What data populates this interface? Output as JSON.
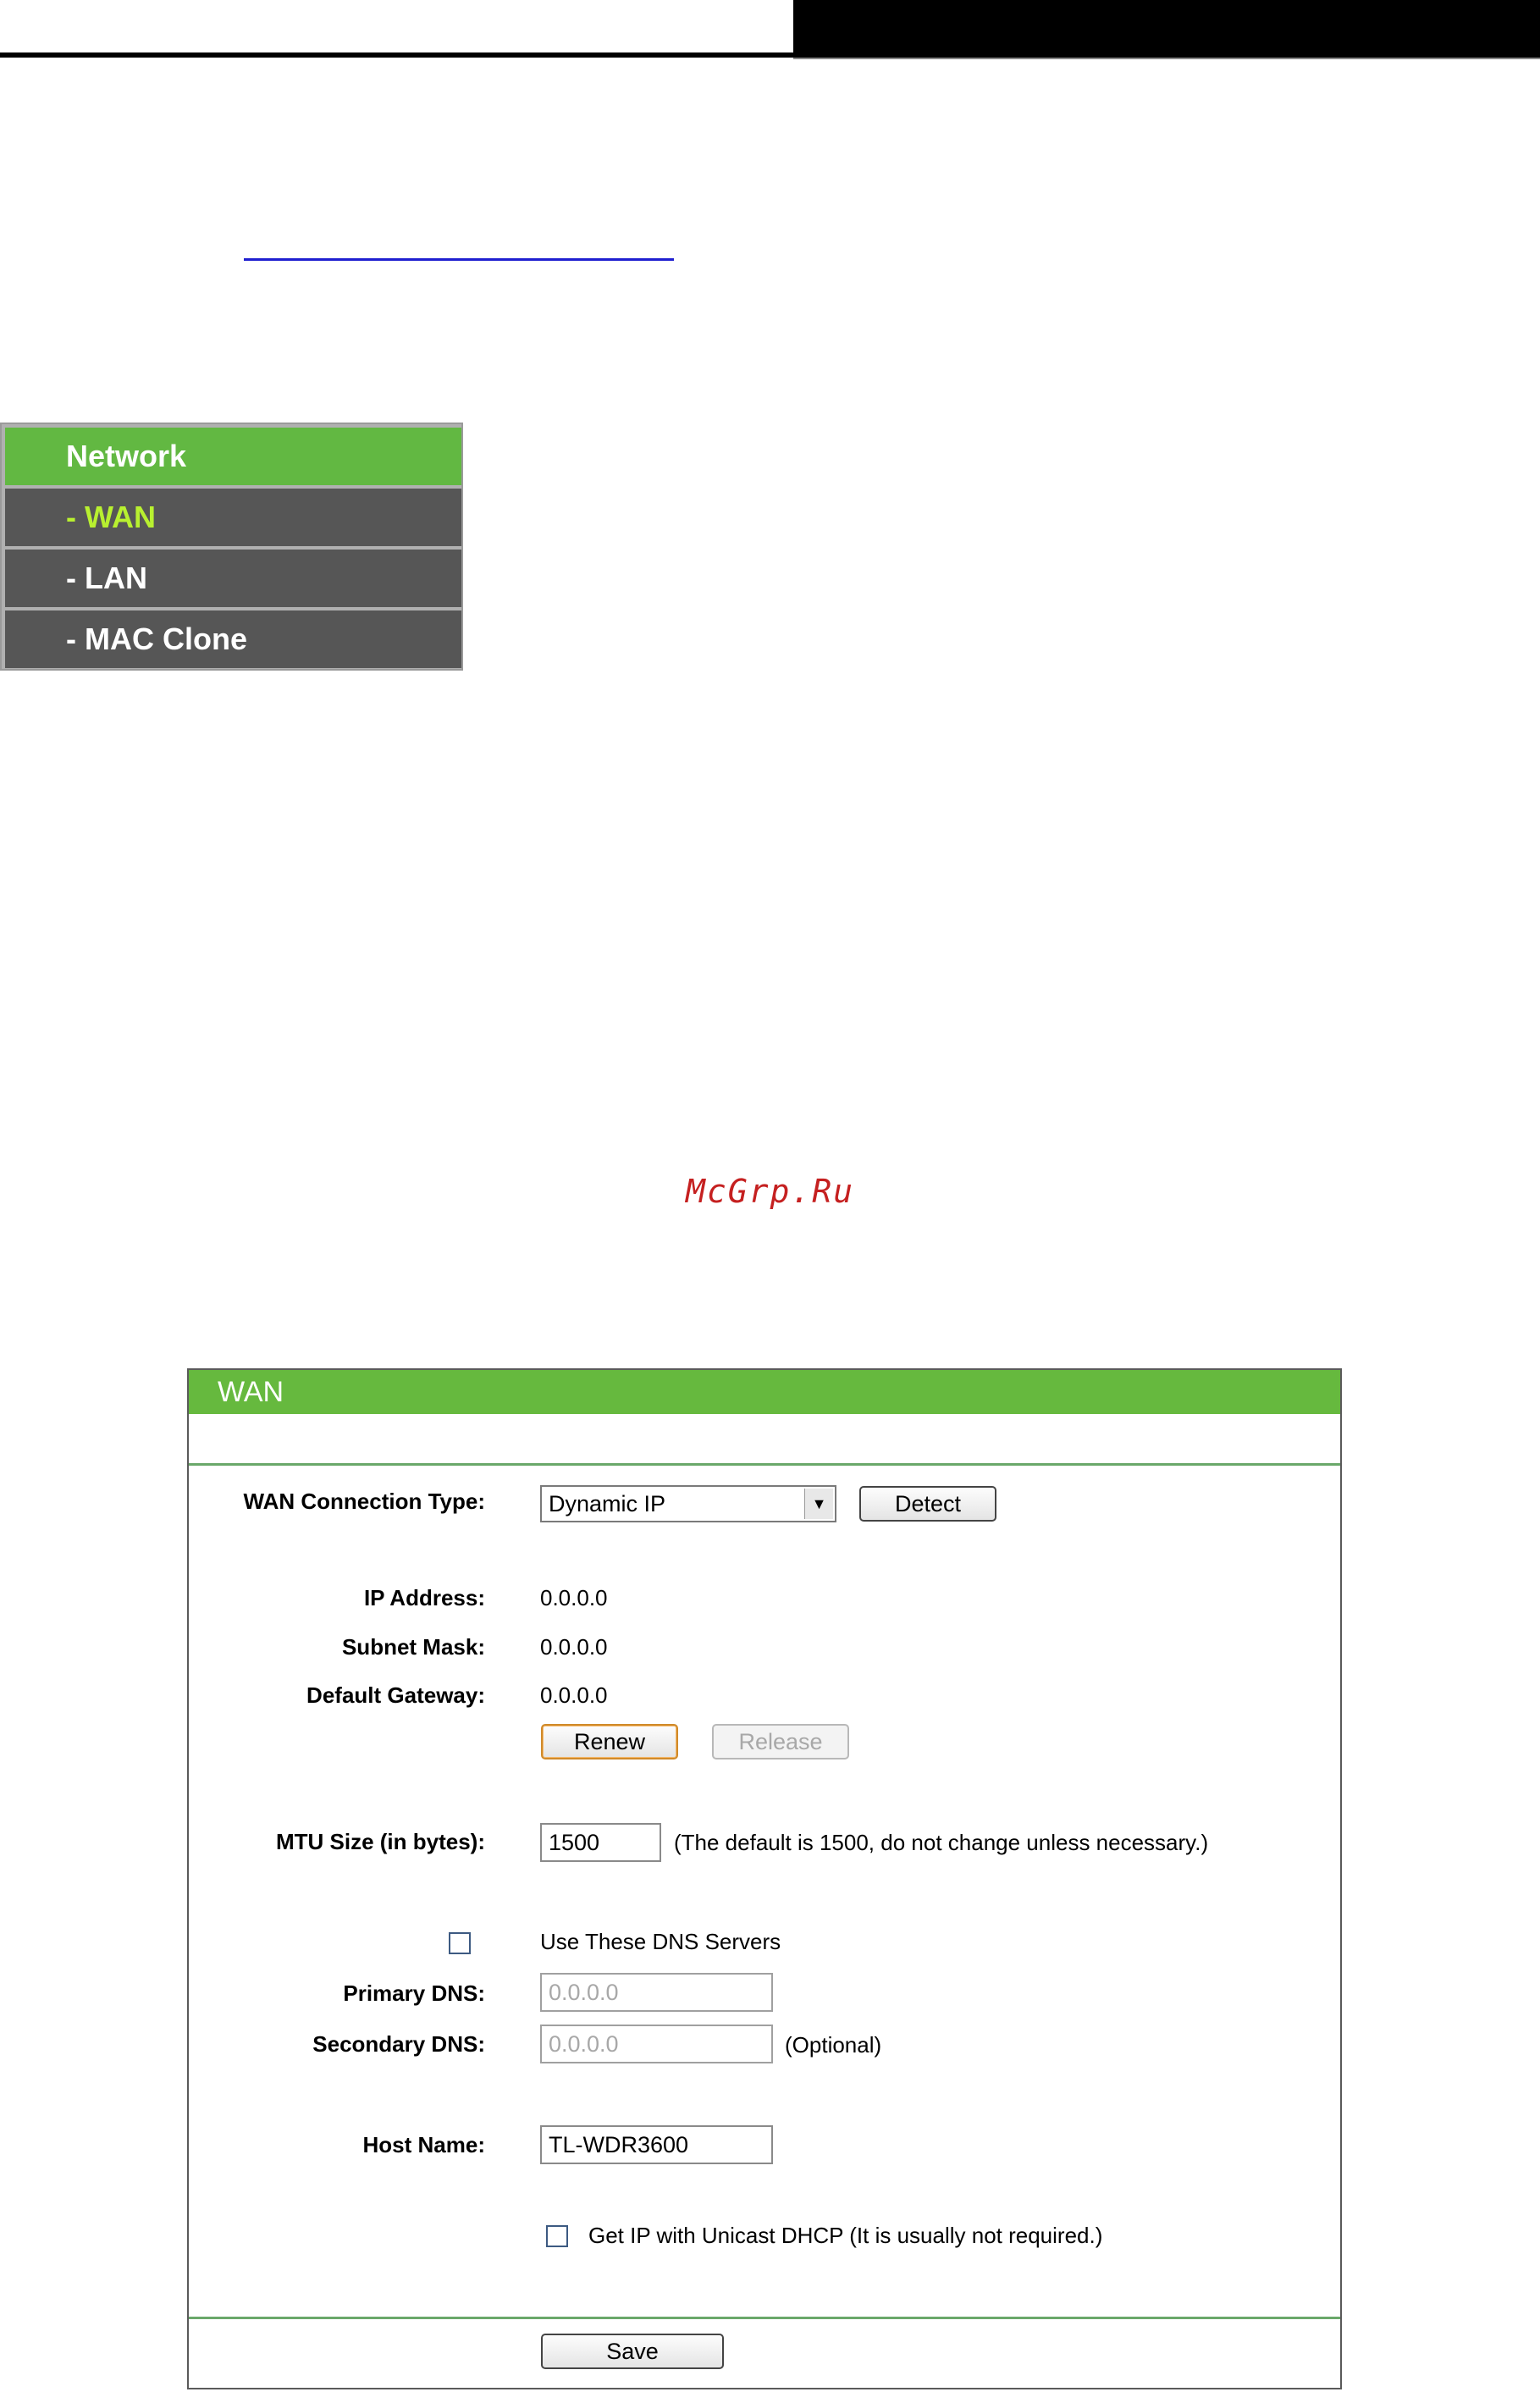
{
  "menu": {
    "header": "Network",
    "items": [
      {
        "label": "- WAN",
        "active": true
      },
      {
        "label": "- LAN",
        "active": false
      },
      {
        "label": "- MAC Clone",
        "active": false
      }
    ]
  },
  "watermark": "McGrp.Ru",
  "wan": {
    "title": "WAN",
    "connection_type_label": "WAN Connection Type:",
    "connection_type_value": "Dynamic IP",
    "detect_label": "Detect",
    "ip_label": "IP Address:",
    "ip_value": "0.0.0.0",
    "subnet_label": "Subnet Mask:",
    "subnet_value": "0.0.0.0",
    "gateway_label": "Default Gateway:",
    "gateway_value": "0.0.0.0",
    "renew_label": "Renew",
    "release_label": "Release",
    "mtu_label": "MTU Size (in bytes):",
    "mtu_value": "1500",
    "mtu_note": "(The default is 1500, do not change unless necessary.)",
    "use_dns_label": "Use These DNS Servers",
    "use_dns_checked": false,
    "primary_dns_label": "Primary DNS:",
    "primary_dns_value": "0.0.0.0",
    "secondary_dns_label": "Secondary DNS:",
    "secondary_dns_value": "0.0.0.0",
    "optional_note": "(Optional)",
    "host_name_label": "Host Name:",
    "host_name_value": "TL-WDR3600",
    "unicast_label": "Get IP with Unicast DHCP (It is usually not required.)",
    "unicast_checked": false,
    "save_label": "Save"
  },
  "colors": {
    "menu_green": "#62b842",
    "menu_gray": "#565656",
    "menu_active_text": "#b8f030",
    "panel_green": "#66b93e",
    "watermark": "#c52020"
  }
}
